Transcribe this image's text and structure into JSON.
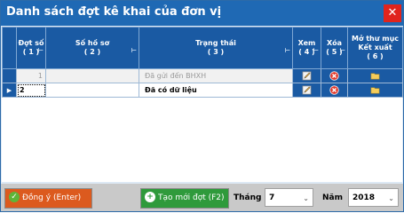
{
  "window": {
    "title": "Danh sách đợt kê khai của đơn vị",
    "close_glyph": "✕"
  },
  "table": {
    "headers": [
      {
        "label": "Đợt số",
        "sub": "( 1 )"
      },
      {
        "label": "Số hồ sơ",
        "sub": "( 2 )"
      },
      {
        "label": "Trạng thái",
        "sub": "( 3 )"
      },
      {
        "label": "Xem",
        "sub": "( 4 )"
      },
      {
        "label": "Xóa",
        "sub": "( 5 )"
      },
      {
        "label": "Mở thư mục Kết xuất",
        "sub": "( 6 )"
      }
    ],
    "rows": [
      {
        "dot_so": "1",
        "so_ho_so": "",
        "trang_thai": "Đã gửi đến BHXH"
      },
      {
        "dot_so": "2",
        "so_ho_so": "",
        "trang_thai": "Đã có dữ liệu"
      }
    ]
  },
  "footer": {
    "ok_label": "Đồng ý (Enter)",
    "new_label": "Tạo mới đợt (F2)",
    "month_label": "Tháng",
    "month_value": "7",
    "year_label": "Năm",
    "year_value": "2018"
  },
  "colors": {
    "titlebar": "#1f69b4",
    "header": "#1a5aa3",
    "close": "#e0241d",
    "ok_button": "#dc5a1e",
    "new_button": "#2f9a3b"
  }
}
